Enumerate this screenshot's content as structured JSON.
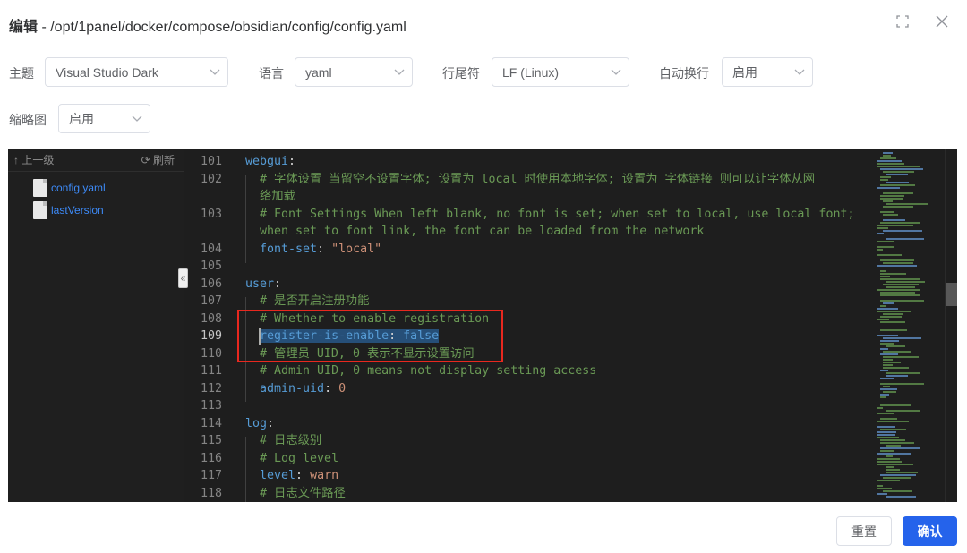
{
  "dialog": {
    "title_prefix": "编辑",
    "title_path": " - /opt/1panel/docker/compose/obsidian/config/config.yaml"
  },
  "options": {
    "theme_label": "主题",
    "theme_value": "Visual Studio Dark",
    "language_label": "语言",
    "language_value": "yaml",
    "eol_label": "行尾符",
    "eol_value": "LF (Linux)",
    "wrap_label": "自动换行",
    "wrap_value": "启用",
    "minimap_label": "缩略图",
    "minimap_value": "启用"
  },
  "file_tree": {
    "up_label": "↑ 上一级",
    "refresh_label": "⟳ 刷新",
    "files": [
      "config.yaml",
      "lastVersion"
    ],
    "collapse_glyph": "«"
  },
  "code_lines": [
    {
      "no": "101",
      "segs": [
        {
          "t": "webgui",
          "c": "k"
        },
        {
          "t": ":",
          "c": "p"
        }
      ]
    },
    {
      "no": "102",
      "segs": [
        {
          "t": "  # 字体设置 当留空不设置字体; 设置为 local 时使用本地字体; 设置为 字体链接 则可以让字体从网",
          "c": "c"
        }
      ]
    },
    {
      "no": "",
      "segs": [
        {
          "t": "  络加载",
          "c": "c"
        }
      ]
    },
    {
      "no": "103",
      "segs": [
        {
          "t": "  # Font Settings When left blank, no font is set; when set to local, use local font;",
          "c": "c"
        }
      ]
    },
    {
      "no": "",
      "segs": [
        {
          "t": "  when set to font link, the font can be loaded from the network",
          "c": "c"
        }
      ]
    },
    {
      "no": "104",
      "segs": [
        {
          "t": "  ",
          "c": "p"
        },
        {
          "t": "font-set",
          "c": "k"
        },
        {
          "t": ": ",
          "c": "p"
        },
        {
          "t": "\"local\"",
          "c": "s"
        }
      ]
    },
    {
      "no": "105",
      "segs": []
    },
    {
      "no": "106",
      "segs": [
        {
          "t": "user",
          "c": "k"
        },
        {
          "t": ":",
          "c": "p"
        }
      ]
    },
    {
      "no": "107",
      "segs": [
        {
          "t": "  # 是否开启注册功能",
          "c": "c"
        }
      ]
    },
    {
      "no": "108",
      "segs": [
        {
          "t": "  # Whether to enable registration",
          "c": "c"
        }
      ]
    },
    {
      "no": "109",
      "active": true,
      "segs": [
        {
          "t": "  ",
          "c": "p"
        },
        {
          "t": "register-is-enable",
          "c": "k",
          "sel": true
        },
        {
          "t": ": ",
          "c": "p",
          "sel": true
        },
        {
          "t": "false",
          "c": "k",
          "sel": true
        }
      ]
    },
    {
      "no": "110",
      "segs": [
        {
          "t": "  # 管理员 UID, 0 表示不显示设置访问",
          "c": "c"
        }
      ]
    },
    {
      "no": "111",
      "segs": [
        {
          "t": "  # Admin UID, 0 means not display setting access",
          "c": "c"
        }
      ]
    },
    {
      "no": "112",
      "segs": [
        {
          "t": "  ",
          "c": "p"
        },
        {
          "t": "admin-uid",
          "c": "k"
        },
        {
          "t": ": ",
          "c": "p"
        },
        {
          "t": "0",
          "c": "s"
        }
      ]
    },
    {
      "no": "113",
      "segs": []
    },
    {
      "no": "114",
      "segs": [
        {
          "t": "log",
          "c": "k"
        },
        {
          "t": ":",
          "c": "p"
        }
      ]
    },
    {
      "no": "115",
      "segs": [
        {
          "t": "  # 日志级别",
          "c": "c"
        }
      ]
    },
    {
      "no": "116",
      "segs": [
        {
          "t": "  # Log level",
          "c": "c"
        }
      ]
    },
    {
      "no": "117",
      "segs": [
        {
          "t": "  ",
          "c": "p"
        },
        {
          "t": "level",
          "c": "k"
        },
        {
          "t": ": ",
          "c": "p"
        },
        {
          "t": "warn",
          "c": "s"
        }
      ]
    },
    {
      "no": "118",
      "segs": [
        {
          "t": "  # 日志文件路径",
          "c": "c"
        }
      ]
    }
  ],
  "buttons": {
    "reset": "重置",
    "confirm": "确认"
  },
  "colors": {
    "accent": "#2563eb",
    "highlight_box": "#e8281f",
    "editor_bg": "#1e1e1e"
  },
  "icons": [
    "fullscreen-icon",
    "close-icon",
    "chevron-down-icon",
    "file-icon",
    "refresh-icon"
  ]
}
